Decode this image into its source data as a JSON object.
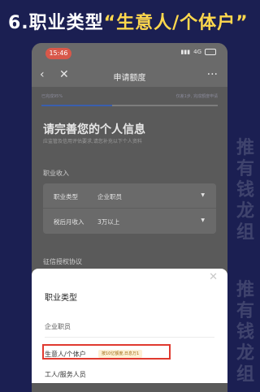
{
  "banner": {
    "prefix": "6.职业类型",
    "highlight": "“生意人/个体户”",
    "watermark": "推有钱龙组"
  },
  "colors": {
    "background": "#1b1f52",
    "highlight_text": "#ffd84d",
    "annotation_box": "#e0392f",
    "progress_fill": "#3a5fae"
  },
  "status_bar": {
    "time": "15:46",
    "network": "4G"
  },
  "nav": {
    "title": "申请额度",
    "back_icon": "chevron-left",
    "close_icon": "close",
    "more_icon": "more-dots"
  },
  "progress": {
    "done_label": "已完成95%",
    "next_label": "仅差1步, 完成额度申请",
    "fraction": 0.4
  },
  "page": {
    "heading": "请完善您的个人信息",
    "subtitle": "应监管及信用评估要求,请您补充以下个人资料"
  },
  "sections": {
    "income_label": "职业收入",
    "auth_label": "征信授权协议"
  },
  "form": {
    "rows": [
      {
        "label": "职业类型",
        "value": "企业职员"
      },
      {
        "label": "税后月收入",
        "value": "3万以上"
      }
    ]
  },
  "sheet": {
    "title": "职业类型",
    "items": [
      {
        "label": "企业职员"
      },
      {
        "label": "生意人/个体户",
        "tag": "按10亿额度,日息万1"
      },
      {
        "label": "工人/服务人员"
      }
    ]
  }
}
